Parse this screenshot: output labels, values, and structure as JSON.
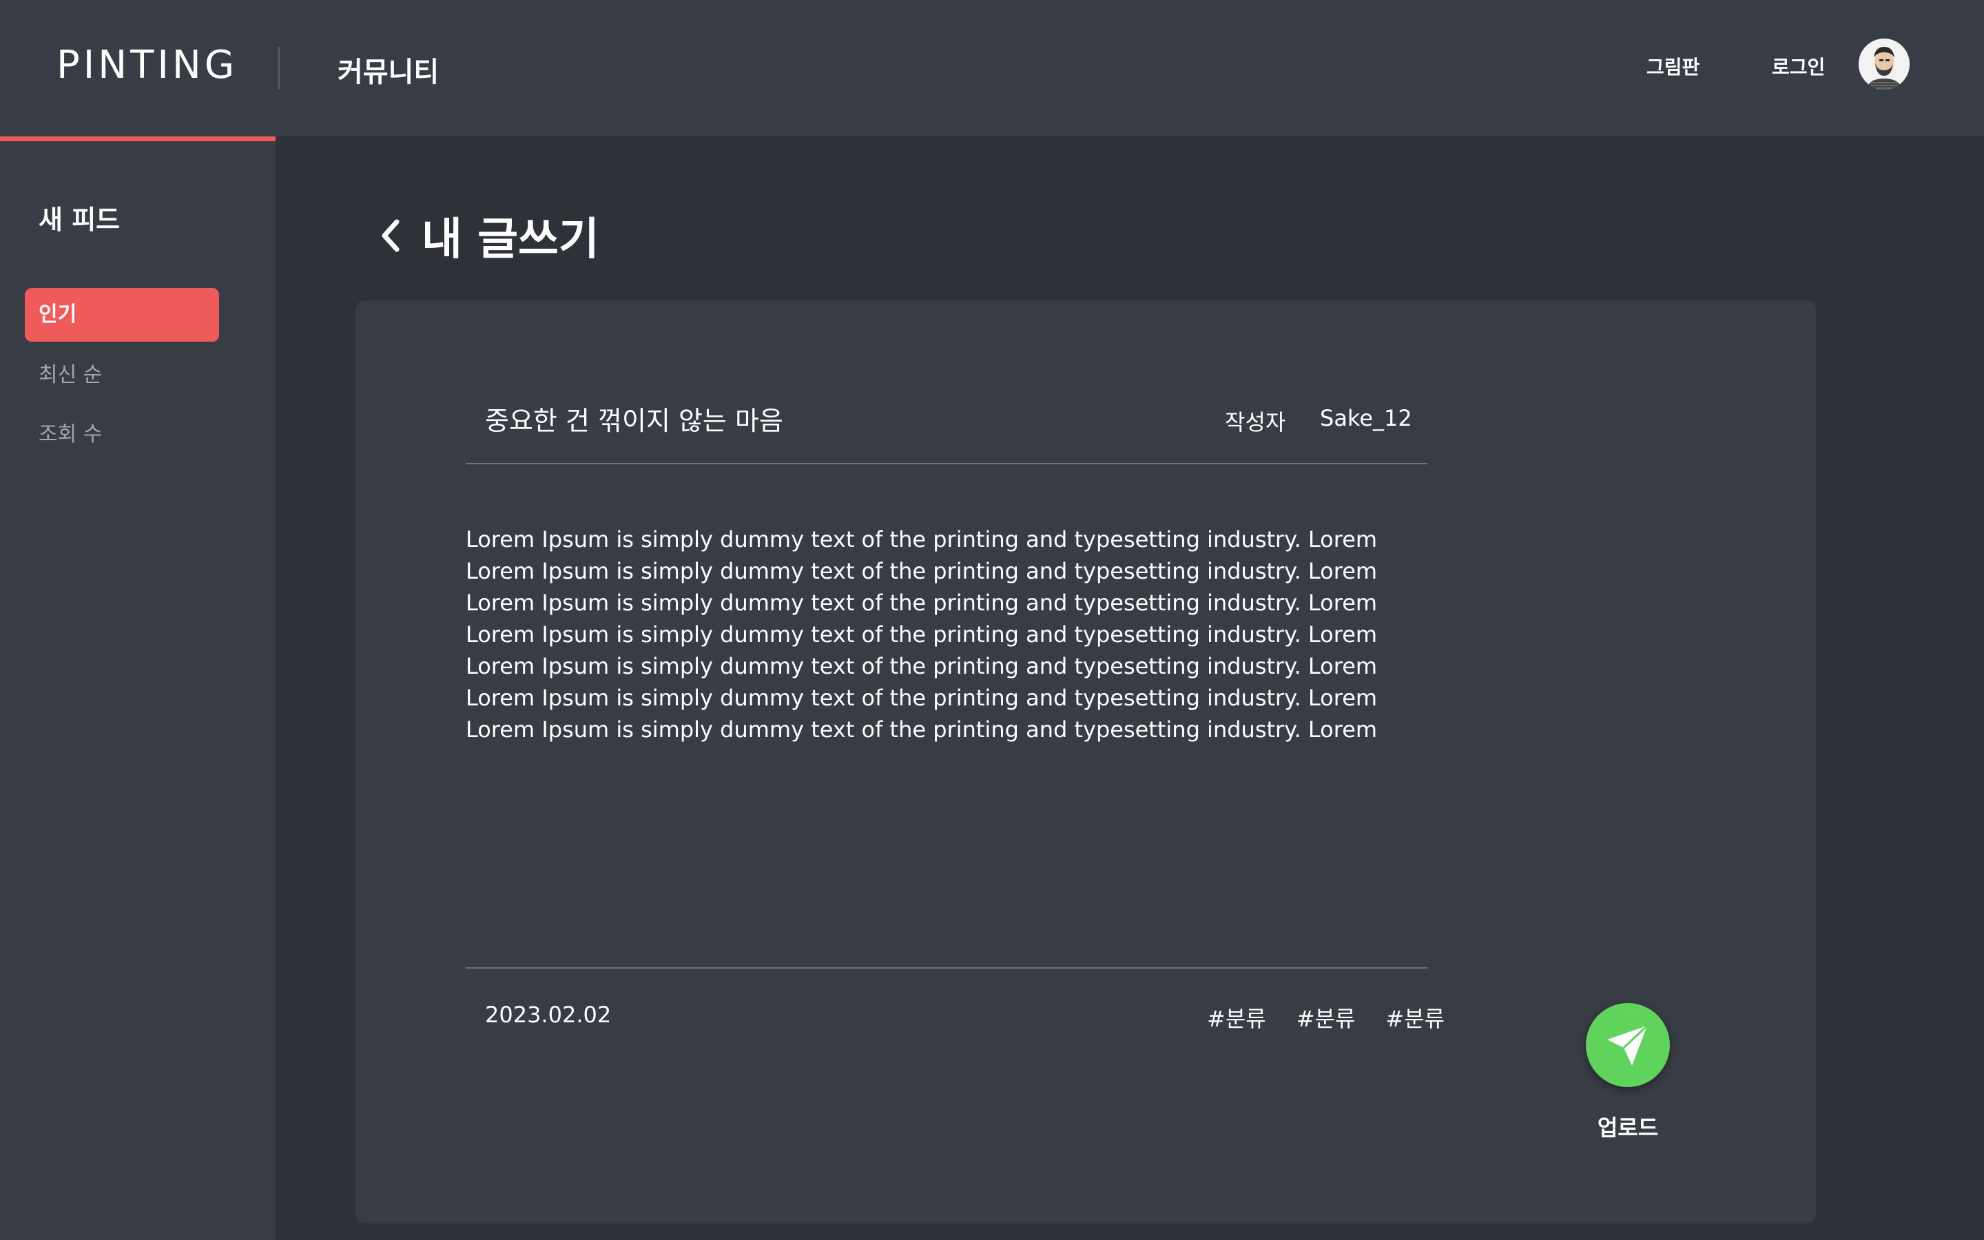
{
  "header": {
    "logo": "PINTING",
    "section": "커뮤니티",
    "nav_board": "그림판",
    "nav_login": "로그인"
  },
  "sidebar": {
    "title": "새 피드",
    "items": [
      {
        "label": "인기",
        "active": true
      },
      {
        "label": "최신 순",
        "active": false
      },
      {
        "label": "조회 수",
        "active": false
      }
    ]
  },
  "page": {
    "title": "내 글쓰기"
  },
  "post": {
    "title": "중요한 건 꺾이지 않는 마음",
    "author_label": "작성자",
    "author": "Sake_12",
    "body": "Lorem Ipsum is simply dummy text of the printing and typesetting industry. Lorem Lorem Ipsum is simply dummy text of the printing and typesetting industry. Lorem Lorem Ipsum is simply dummy text of the printing and typesetting industry. Lorem Lorem Ipsum is simply dummy text of the printing and typesetting industry. Lorem Lorem Ipsum is simply dummy text of the printing and typesetting industry. Lorem Lorem Ipsum is simply dummy text of the printing and typesetting industry. Lorem Lorem Ipsum is simply dummy text of the printing and typesetting industry. Lorem",
    "date": "2023.02.02",
    "tags": [
      "#분류",
      "#분류",
      "#분류"
    ]
  },
  "upload": {
    "label": "업로드"
  },
  "colors": {
    "accent": "#ef5b5b",
    "upload": "#5fd35c",
    "background": "#2e3138",
    "panel": "#383c44"
  },
  "icons": {
    "back": "chevron-left-icon",
    "upload": "paper-plane-icon",
    "avatar": "user-avatar"
  }
}
